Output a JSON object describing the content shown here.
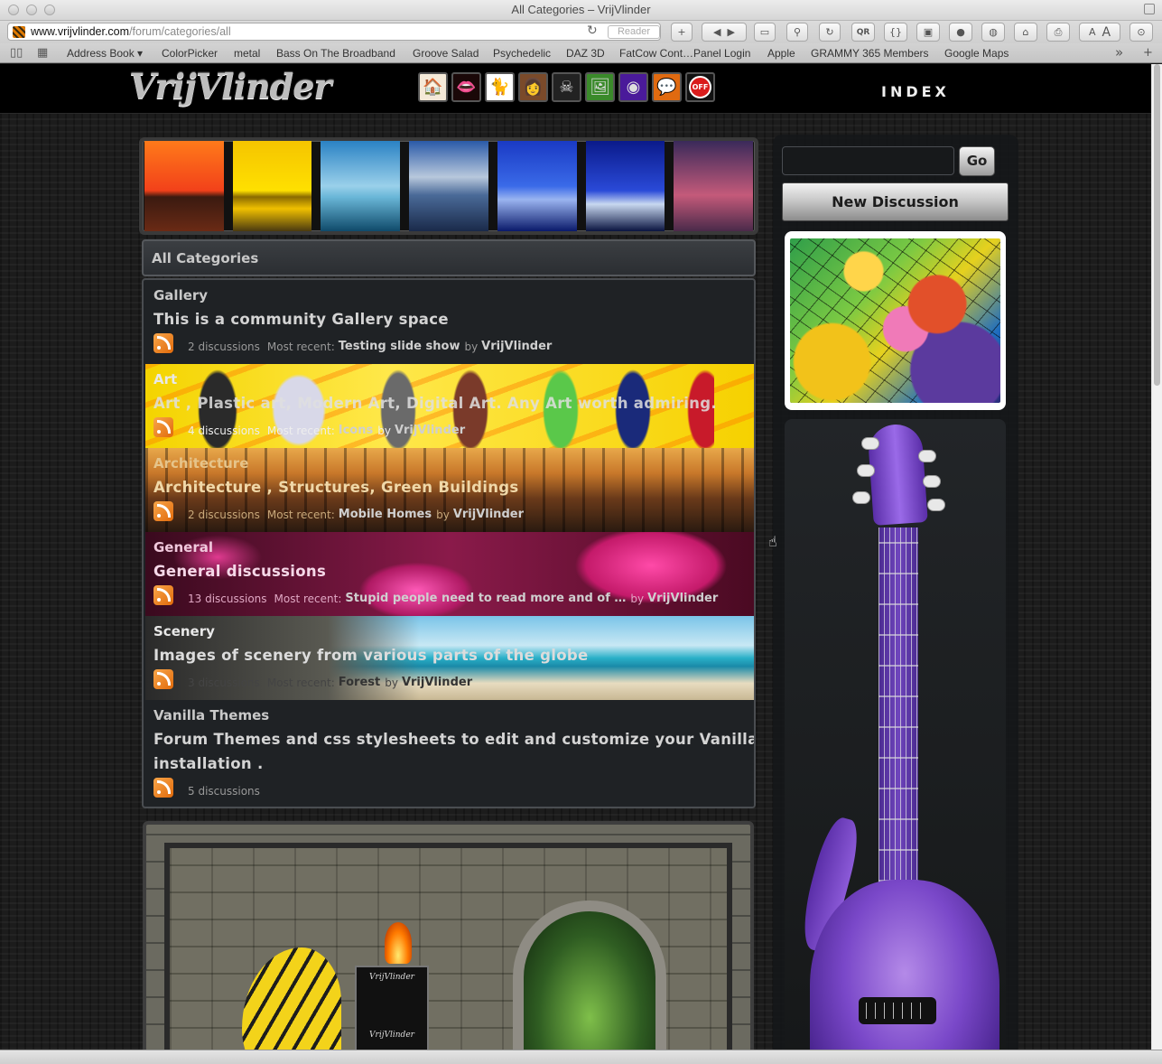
{
  "window": {
    "title": "All Categories – VrijVlinder"
  },
  "toolbar": {
    "url_host": "www.vrijvlinder.com",
    "url_path": "/forum/categories/all",
    "reader_label": "Reader"
  },
  "bookmarks": [
    "Address Book ▾",
    "ColorPicker",
    "metal",
    "Bass On The Broadband",
    "Groove Salad",
    "Psychedelic",
    "DAZ 3D",
    "FatCow Cont…Panel Login",
    "Apple",
    "GRAMMY 365 Members",
    "Google Maps"
  ],
  "site": {
    "logo": "VrijVlinder",
    "index_label": "INDEX",
    "nav_icons": [
      "home-icon",
      "teeth-icon",
      "cat-icon",
      "portrait-icon",
      "skull-icon",
      "photo-icon",
      "music-disc-icon",
      "chat-icon",
      "power-off-icon"
    ],
    "off_label": "OFF"
  },
  "categories_header": "All Categories",
  "categories": [
    {
      "name": "Gallery",
      "description": "This is a community Gallery space",
      "discussions": "2 discussions",
      "recent_label": "Most recent:",
      "recent_title": "Testing slide show",
      "by": "by",
      "author": "VrijVlinder"
    },
    {
      "name": "Art",
      "description": "Art , Plastic art, Modern Art, Digital Art. Any Art worth admiring.",
      "discussions": "4 discussions",
      "recent_label": "Most recent:",
      "recent_title": "Icons",
      "by": "by",
      "author": "VrijVlinder"
    },
    {
      "name": "Architecture",
      "description": "Architecture , Structures, Green Buildings",
      "discussions": "2 discussions",
      "recent_label": "Most recent:",
      "recent_title": "Mobile Homes",
      "by": "by",
      "author": "VrijVlinder"
    },
    {
      "name": "General",
      "description": "General discussions",
      "discussions": "13 discussions",
      "recent_label": "Most recent:",
      "recent_title": "Stupid people need to read more and of …",
      "by": "by",
      "author": "VrijVlinder"
    },
    {
      "name": "Scenery",
      "description": "Images of scenery from various parts of the globe",
      "discussions": "3 discussions",
      "recent_label": "Most recent:",
      "recent_title": "Forest",
      "by": "by",
      "author": "VrijVlinder"
    },
    {
      "name": "Vanilla Themes",
      "description_line1": "Forum Themes and css stylesheets to edit and customize your Vanilla Forum",
      "description_line2": "installation .",
      "discussions": "5 discussions"
    }
  ],
  "sidebar": {
    "search_value": "",
    "go_label": "Go",
    "new_discussion_label": "New Discussion"
  },
  "artwork": {
    "amp_brand": "VrijVlinder"
  }
}
